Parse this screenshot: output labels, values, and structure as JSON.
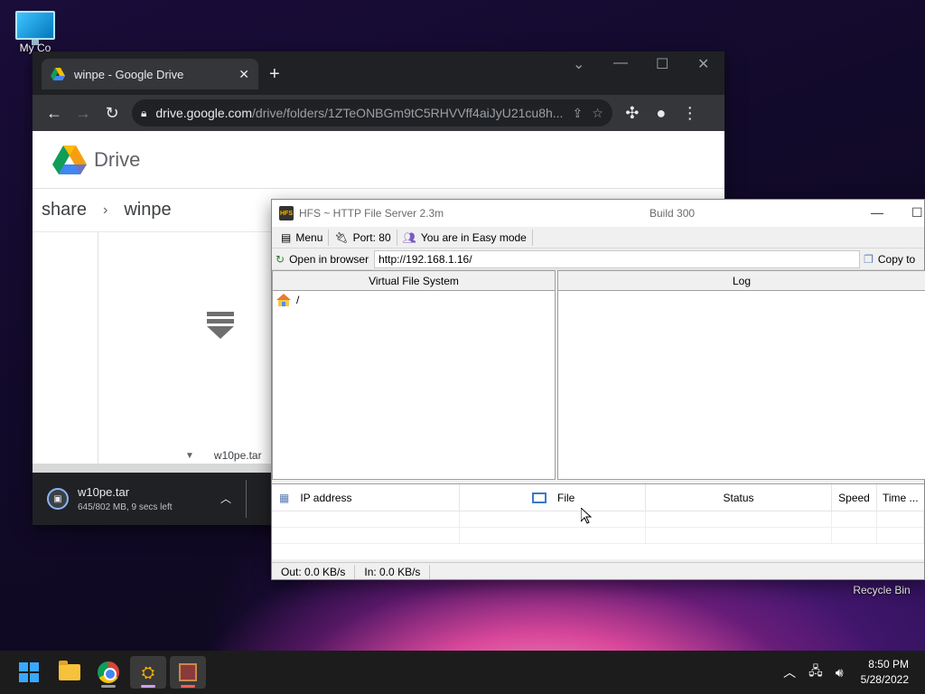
{
  "desktop": {
    "my_computer_label": "My Co",
    "recycle_bin_label": "Recycle Bin"
  },
  "chrome": {
    "tab_title": "winpe - Google Drive",
    "tab_close": "✕",
    "new_tab": "+",
    "url_host": "drive.google.com",
    "url_path": "/drive/folders/1ZTeONBGm9tC5RHVVff4aiJyU21cu8h...",
    "drive_title": "Drive",
    "breadcrumb": [
      "share",
      "winpe"
    ],
    "file_name": "w10pe.tar",
    "download": {
      "name": "w10pe.tar",
      "progress_text": "645/802 MB, 9 secs left"
    }
  },
  "hfs": {
    "title": "HFS ~ HTTP File Server 2.3m",
    "build": "Build 300",
    "menu": {
      "menu_label": "Menu",
      "port_label": "Port: 80",
      "mode_label": "You are in Easy mode"
    },
    "open_in_browser": "Open in browser",
    "url": "http://192.168.1.16/",
    "copy_label": "Copy to",
    "vfs_header": "Virtual File System",
    "log_header": "Log",
    "vfs_root": "/",
    "columns": [
      "IP address",
      "File",
      "Status",
      "Speed",
      "Time ..."
    ],
    "status": {
      "out": "Out: 0.0 KB/s",
      "in": "In: 0.0 KB/s"
    }
  },
  "taskbar": {
    "time": "8:50 PM",
    "date": "5/28/2022"
  },
  "icons": {
    "accent": "#0078d4",
    "drive_logo": "google-drive-icon",
    "hfs_logo": "hfs-icon"
  }
}
